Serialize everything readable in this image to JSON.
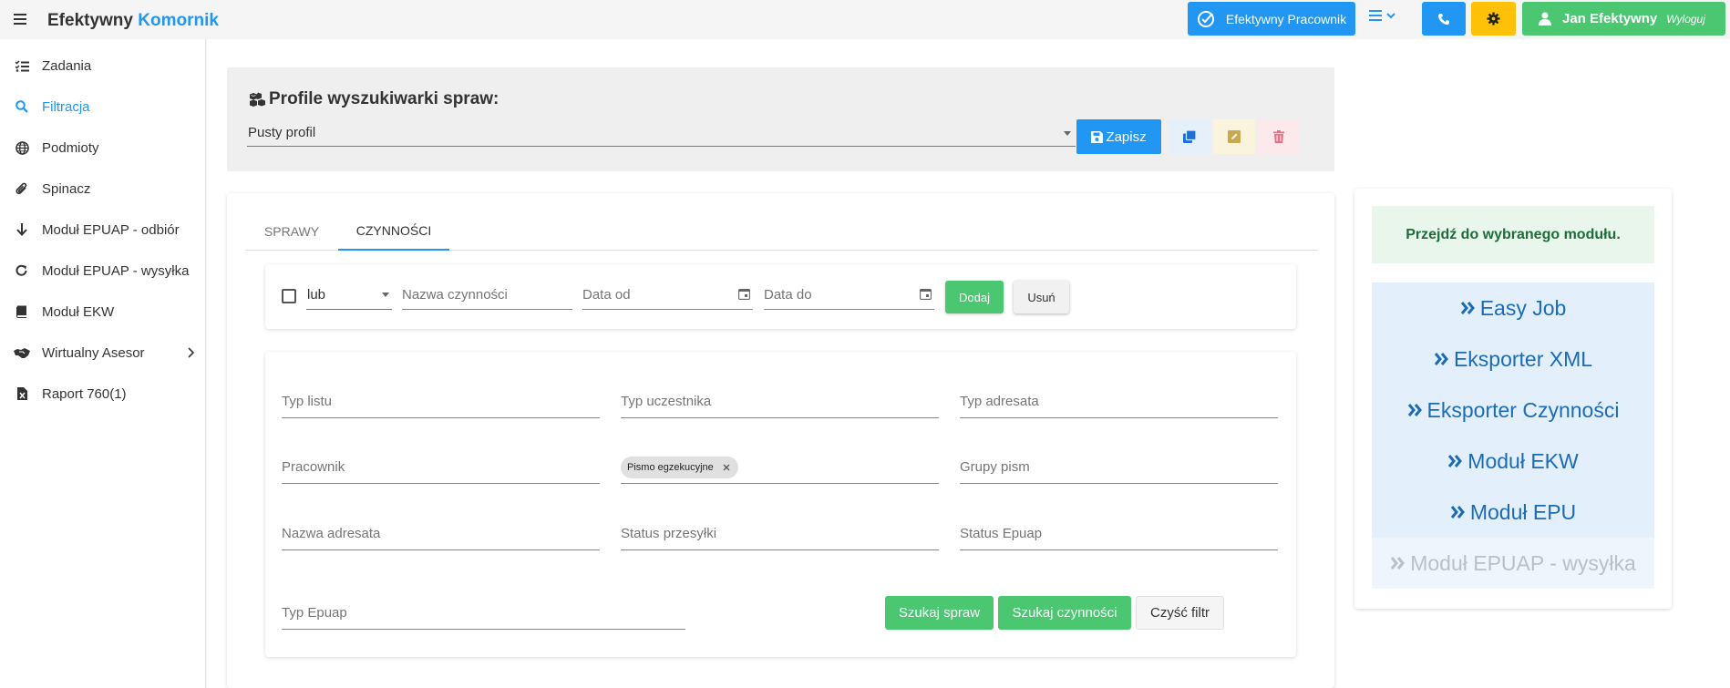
{
  "brand": {
    "part1": "Efektywny",
    "part2": "Komornik"
  },
  "topbar": {
    "worker_button": "Efektywny Pracownik",
    "user_name": "Jan Efektywny",
    "logout_label": "Wyloguj",
    "colors": {
      "worker": "#2196f3",
      "phone": "#2196f3",
      "settings": "#ffc107",
      "user": "#4cc771"
    }
  },
  "sidebar": {
    "items": [
      {
        "label": "Zadania",
        "icon": "tasks-list-icon"
      },
      {
        "label": "Filtracja",
        "icon": "search-icon",
        "active": true
      },
      {
        "label": "Podmioty",
        "icon": "globe-icon"
      },
      {
        "label": "Spinacz",
        "icon": "paperclip-icon"
      },
      {
        "label": "Moduł EPUAP - odbiór",
        "icon": "arrow-down-icon"
      },
      {
        "label": "Moduł EPUAP - wysyłka",
        "icon": "redo-icon"
      },
      {
        "label": "Moduł EKW",
        "icon": "book-icon"
      },
      {
        "label": "Wirtualny Asesor",
        "icon": "handshake-icon"
      },
      {
        "label": "Raport 760(1)",
        "icon": "excel-file-icon"
      }
    ]
  },
  "profile": {
    "title": "Profile wyszukiwarki spraw:",
    "selected": "Pusty profil",
    "save_label": "Zapisz"
  },
  "tabs": [
    {
      "label": "SPRAWY",
      "active": false
    },
    {
      "label": "CZYNNOŚCI",
      "active": true
    }
  ],
  "filter_row": {
    "logic_value": "lub",
    "name_placeholder": "Nazwa czynności",
    "date_from_placeholder": "Data od",
    "date_to_placeholder": "Data do",
    "add_label": "Dodaj",
    "remove_label": "Usuń"
  },
  "fields": {
    "typ_listu": "Typ listu",
    "typ_uczestnika": "Typ uczestnika",
    "typ_adresata": "Typ adresata",
    "pracownik": "Pracownik",
    "chip": "Pismo egzekucyjne",
    "grupy_pism": "Grupy pism",
    "nazwa_adresata": "Nazwa adresata",
    "status_przesylki": "Status przesyłki",
    "status_epuap": "Status Epuap",
    "typ_epuap": "Typ Epuap"
  },
  "actions": {
    "search_cases": "Szukaj spraw",
    "search_actions": "Szukaj czynności",
    "clear": "Czyść filtr"
  },
  "modules": {
    "heading": "Przejdź do wybranego modułu.",
    "items": [
      {
        "label": "Easy Job",
        "disabled": false
      },
      {
        "label": "Eksporter XML",
        "disabled": false
      },
      {
        "label": "Eksporter Czynności",
        "disabled": false
      },
      {
        "label": "Moduł EKW",
        "disabled": false
      },
      {
        "label": "Moduł EPU",
        "disabled": false
      },
      {
        "label": "Moduł EPUAP - wysyłka",
        "disabled": true
      }
    ]
  }
}
